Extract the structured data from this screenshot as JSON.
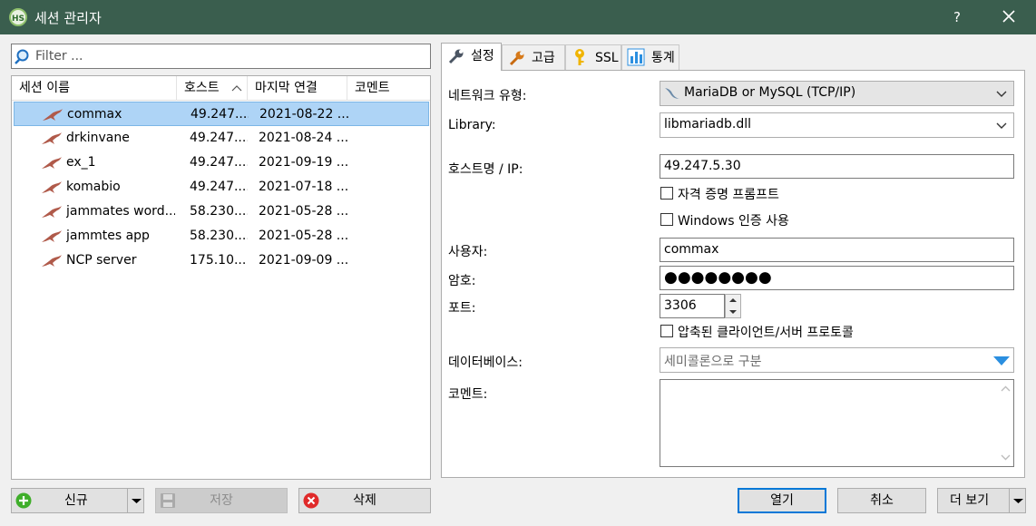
{
  "window": {
    "title": "세션 관리자",
    "help_label": "?"
  },
  "filter": {
    "placeholder": "Filter ..."
  },
  "session_list": {
    "columns": [
      "세션 이름",
      "호스트",
      "마지막 연결",
      "코멘트"
    ],
    "sort_indicator": "^",
    "rows": [
      {
        "name": "commax",
        "host": "49.247....",
        "last": "2021-08-22 ...",
        "comment": ""
      },
      {
        "name": "drkinvane",
        "host": "49.247....",
        "last": "2021-08-24 ...",
        "comment": ""
      },
      {
        "name": "ex_1",
        "host": "49.247....",
        "last": "2021-09-19 ...",
        "comment": ""
      },
      {
        "name": "komabio",
        "host": "49.247....",
        "last": "2021-07-18 ...",
        "comment": ""
      },
      {
        "name": "jammates word...",
        "host": "58.230....",
        "last": "2021-05-28 ...",
        "comment": ""
      },
      {
        "name": "jammtes app",
        "host": "58.230....",
        "last": "2021-05-28 ...",
        "comment": ""
      },
      {
        "name": "NCP server",
        "host": "175.10...",
        "last": "2021-09-09 ...",
        "comment": ""
      }
    ],
    "selected_index": 0
  },
  "tabs": [
    {
      "label": "설정",
      "icon": "wrench-icon",
      "active": true
    },
    {
      "label": "고급",
      "icon": "wrench-orange-icon",
      "active": false
    },
    {
      "label": "SSL",
      "icon": "key-icon",
      "active": false
    },
    {
      "label": "통계",
      "icon": "bar-chart-icon",
      "active": false
    }
  ],
  "settings": {
    "network_type_label": "네트워크 유형:",
    "network_type_value": "MariaDB or MySQL (TCP/IP)",
    "library_label": "Library:",
    "library_value": "libmariadb.dll",
    "hostname_label": "호스트명 / IP:",
    "hostname_value": "49.247.5.30",
    "prompt_credentials_label": "자격 증명 프롬프트",
    "windows_auth_label": "Windows 인증 사용",
    "user_label": "사용자:",
    "user_value": "commax",
    "password_label": "암호:",
    "password_value": "●●●●●●●●",
    "port_label": "포트:",
    "port_value": "3306",
    "compressed_label": "압축된 클라이언트/서버 프로토콜",
    "databases_label": "데이터베이스:",
    "databases_placeholder": "세미콜론으로 구분",
    "comment_label": "코멘트:"
  },
  "buttons": {
    "new": "신규",
    "save": "저장",
    "delete": "삭제",
    "open": "열기",
    "cancel": "취소",
    "more": "더 보기"
  },
  "colors": {
    "titlebar": "#3a5e4e",
    "selection": "#aed4f6",
    "primary_border": "#0078d7",
    "dropdown_accent": "#2b8fe0"
  }
}
